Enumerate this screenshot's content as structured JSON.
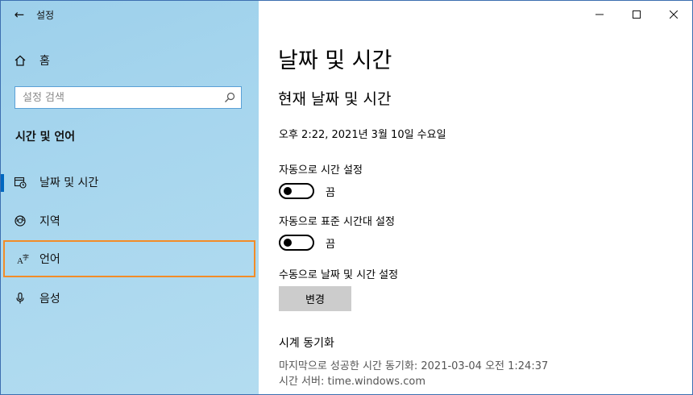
{
  "window": {
    "app_title": "설정",
    "controls": {
      "minimize": "—",
      "maximize": "☐",
      "close": "✕"
    }
  },
  "sidebar": {
    "home_label": "홈",
    "search": {
      "placeholder": "설정 검색",
      "value": ""
    },
    "section_header": "시간 및 언어",
    "items": [
      {
        "label": "날짜 및 시간",
        "icon": "calendar-clock-icon",
        "selected": true
      },
      {
        "label": "지역",
        "icon": "globe-icon"
      },
      {
        "label": "언어",
        "icon": "language-icon",
        "focused": true
      },
      {
        "label": "음성",
        "icon": "microphone-icon"
      }
    ]
  },
  "main": {
    "page_title": "날짜 및 시간",
    "subtitle": "현재 날짜 및 시간",
    "current_datetime": "오후 2:22, 2021년 3월 10일 수요일",
    "auto_time": {
      "label": "자동으로 시간 설정",
      "state": "끔"
    },
    "auto_timezone": {
      "label": "자동으로 표준 시간대 설정",
      "state": "끔"
    },
    "manual": {
      "label": "수동으로 날짜 및 시간 설정",
      "button": "변경"
    },
    "sync": {
      "title": "시계 동기화",
      "last_sync": "마지막으로 성공한 시간 동기화: 2021-03-04 오전 1:24:37",
      "server": "시간 서버: time.windows.com"
    }
  },
  "colors": {
    "accent": "#0067c0",
    "focus_outline": "#f28c28",
    "sidebar_bg": "#a7d6ee",
    "button_bg": "#cccccc"
  }
}
